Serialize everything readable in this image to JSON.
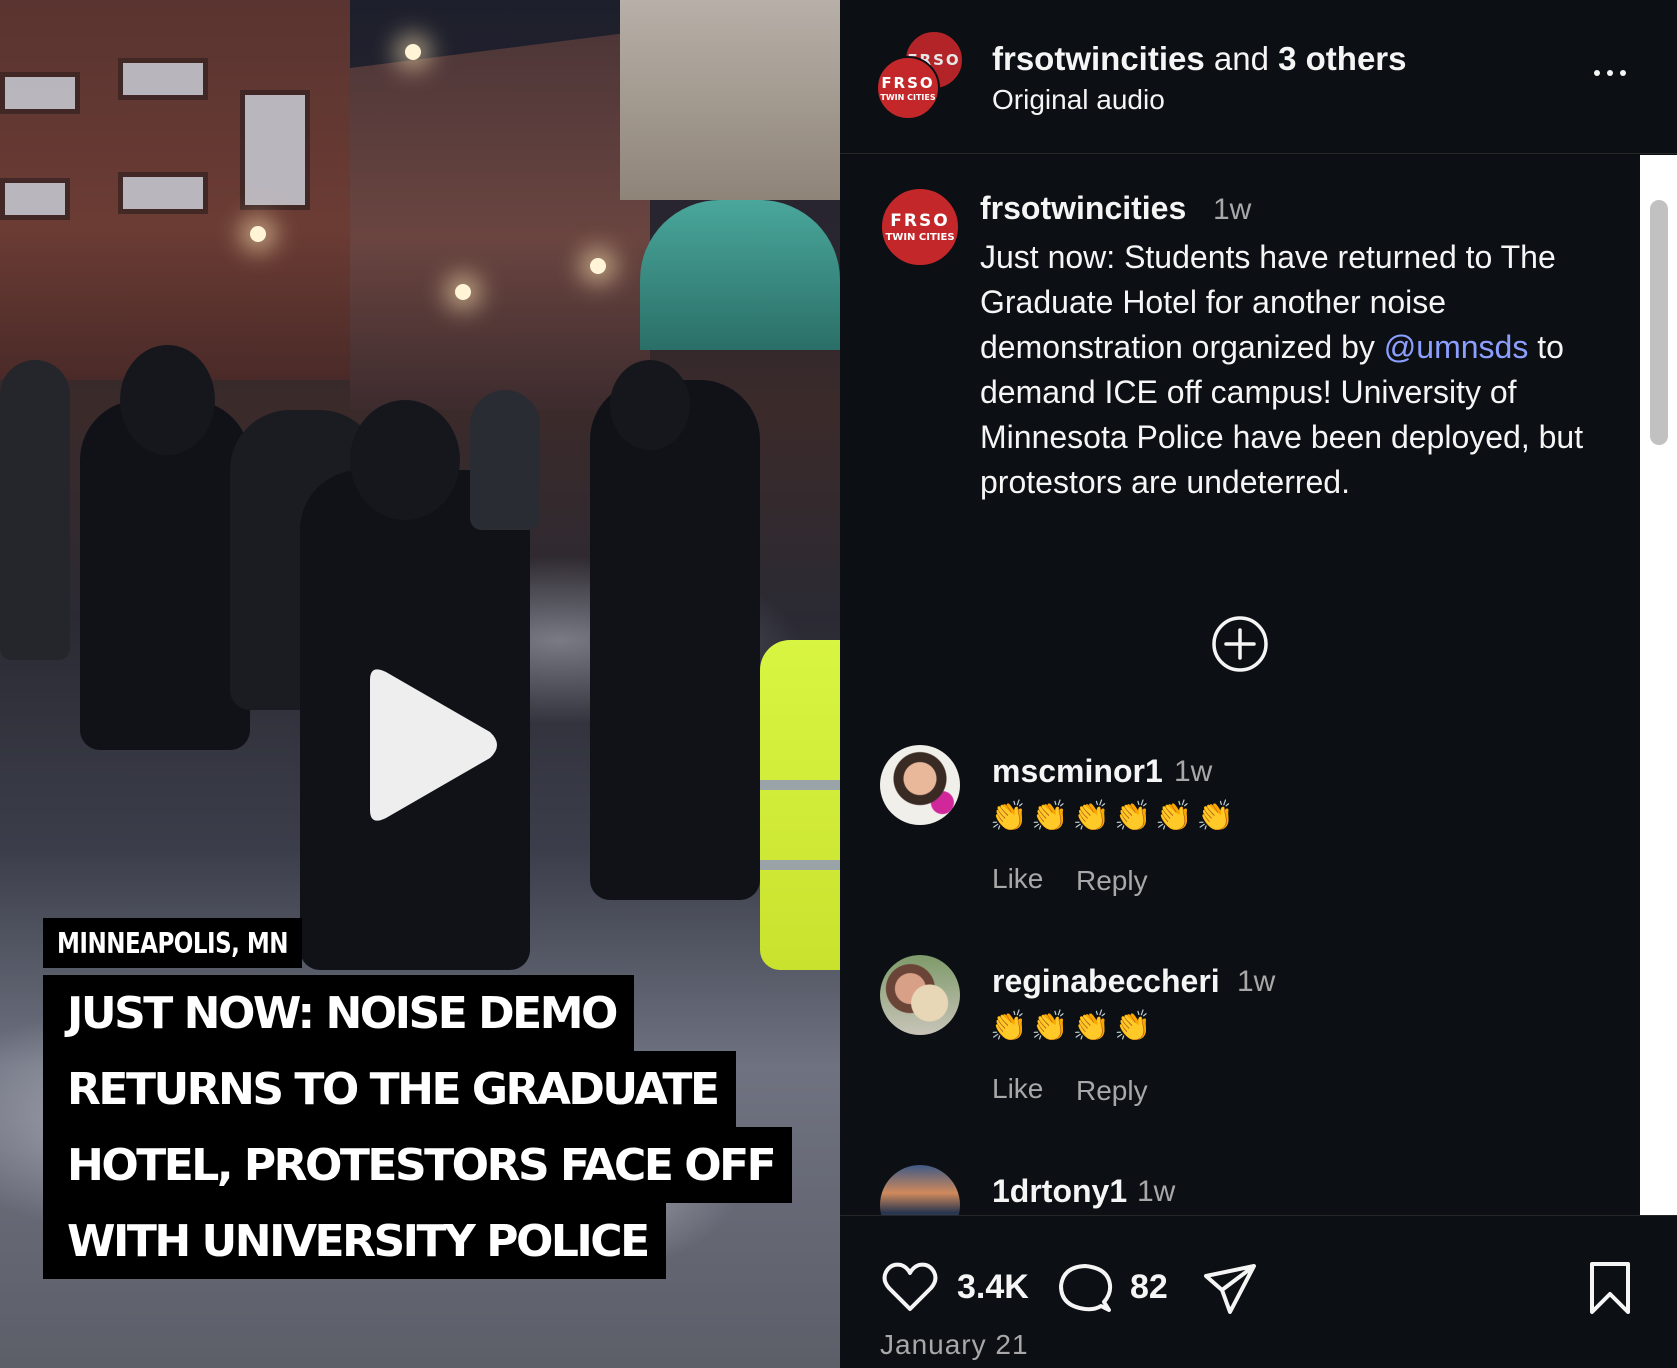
{
  "video": {
    "location_label": "MINNEAPOLIS, MN",
    "headline_lines": [
      "JUST NOW: NOISE DEMO",
      "RETURNS TO THE GRADUATE",
      "HOTEL, PROTESTORS FACE OFF",
      "WITH UNIVERSITY POLICE"
    ],
    "play_icon": "play-icon"
  },
  "header": {
    "username": "frsotwincities",
    "connector": " and ",
    "others": "3 others",
    "audio": "Original audio",
    "avatar_text": "FRSO",
    "avatar_subtext": "TWIN CITIES",
    "more_icon": "more-horizontal-icon"
  },
  "caption": {
    "username": "frsotwincities",
    "time": "1w",
    "text_before": "Just now: Students have returned to The Graduate Hotel for another noise demonstration organized by ",
    "mention": "@umnsds",
    "text_after": " to demand ICE off campus! University of Minnesota Police have been deployed, but protestors are undeterred."
  },
  "load_more_icon": "plus-circle-icon",
  "comments": [
    {
      "username": "mscminor1",
      "time": "1w",
      "text": "👏👏👏👏👏👏",
      "like": "Like",
      "reply": "Reply"
    },
    {
      "username": "reginabeccheri",
      "time": "1w",
      "text": "👏👏👏👏",
      "like": "Like",
      "reply": "Reply"
    },
    {
      "username": "1drtony1",
      "time": "1w"
    }
  ],
  "actions": {
    "likes": "3.4K",
    "comments": "82",
    "date": "January 21",
    "icons": [
      "heart-icon",
      "comment-icon",
      "share-icon",
      "bookmark-icon"
    ]
  },
  "colors": {
    "panel_bg": "#0c1014",
    "brand_red": "#c4272a",
    "mention": "#8c9fff",
    "muted": "#a8a8a8"
  }
}
